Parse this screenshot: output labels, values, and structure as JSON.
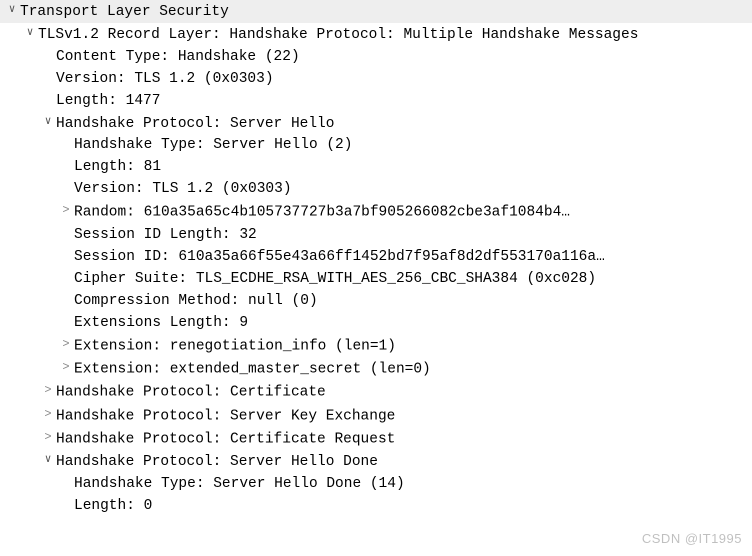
{
  "root": {
    "label": "Transport Layer Security"
  },
  "record": {
    "label": "TLSv1.2 Record Layer: Handshake Protocol: Multiple Handshake Messages",
    "content_type": "Content Type: Handshake (22)",
    "version": "Version: TLS 1.2 (0x0303)",
    "length": "Length: 1477"
  },
  "server_hello": {
    "label": "Handshake Protocol: Server Hello",
    "type": "Handshake Type: Server Hello (2)",
    "length": "Length: 81",
    "version": "Version: TLS 1.2 (0x0303)",
    "random": "Random: 610a35a65c4b105737727b3a7bf905266082cbe3af1084b4…",
    "session_id_len": "Session ID Length: 32",
    "session_id": "Session ID: 610a35a66f55e43a66ff1452bd7f95af8d2df553170a116a…",
    "cipher": "Cipher Suite: TLS_ECDHE_RSA_WITH_AES_256_CBC_SHA384 (0xc028)",
    "compression": "Compression Method: null (0)",
    "ext_len": "Extensions Length: 9",
    "ext_reneg": "Extension: renegotiation_info (len=1)",
    "ext_ems": "Extension: extended_master_secret (len=0)"
  },
  "certificate": {
    "label": "Handshake Protocol: Certificate"
  },
  "server_key_exchange": {
    "label": "Handshake Protocol: Server Key Exchange"
  },
  "certificate_request": {
    "label": "Handshake Protocol: Certificate Request"
  },
  "server_hello_done": {
    "label": "Handshake Protocol: Server Hello Done",
    "type": "Handshake Type: Server Hello Done (14)",
    "length": "Length: 0"
  },
  "watermark": "CSDN @IT1995"
}
